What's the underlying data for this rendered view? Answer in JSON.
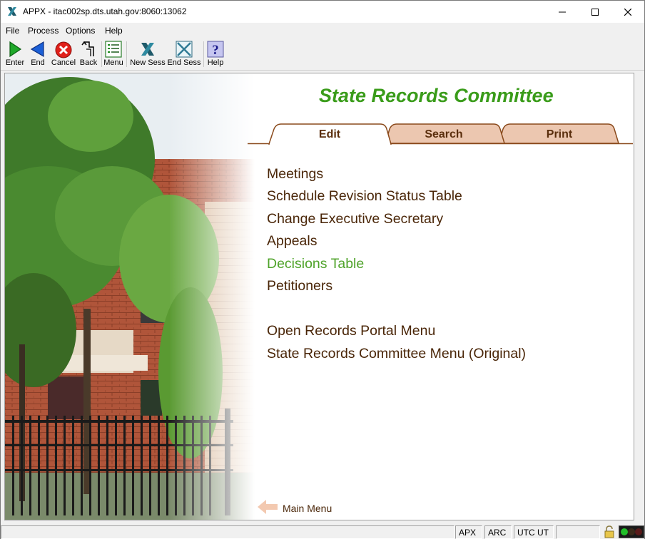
{
  "window": {
    "title": "APPX - itac002sp.dts.utah.gov:8060:13062"
  },
  "menubar": {
    "items": [
      "File",
      "Process",
      "Options",
      "Help"
    ]
  },
  "toolbar": {
    "enter": "Enter",
    "end": "End",
    "cancel": "Cancel",
    "back": "Back",
    "menu": "Menu",
    "new_sess": "New Sess",
    "end_sess": "End Sess",
    "help": "Help"
  },
  "page": {
    "title": "State Records Committee",
    "tabs": [
      {
        "label": "Edit",
        "active": true
      },
      {
        "label": "Search",
        "active": false
      },
      {
        "label": "Print",
        "active": false
      }
    ],
    "menu_items": [
      {
        "label": "Meetings",
        "highlighted": false
      },
      {
        "label": "Schedule Revision Status Table",
        "highlighted": false
      },
      {
        "label": "Change Executive Secretary",
        "highlighted": false
      },
      {
        "label": "Appeals",
        "highlighted": false
      },
      {
        "label": "Decisions Table",
        "highlighted": true
      },
      {
        "label": "Petitioners",
        "highlighted": false
      },
      {
        "label": "Open Records Portal Menu",
        "highlighted": false
      },
      {
        "label": "State Records Committee Menu (Original)",
        "highlighted": false
      }
    ],
    "main_menu": "Main Menu"
  },
  "statusbar": {
    "apx": "APX",
    "arc": "ARC",
    "timezone": "UTC UT"
  },
  "colors": {
    "title_green": "#3a9c1a",
    "highlight_green": "#4fa32a",
    "menu_brown": "#4a2608",
    "tab_fill": "#ecc7b0",
    "tab_border": "#8a4a1c"
  },
  "icons": {
    "app": "appx-x-icon",
    "enter": "play-arrow-icon",
    "end": "back-arrow-icon",
    "cancel": "cancel-x-icon",
    "back": "return-arrow-icon",
    "menu": "list-icon",
    "new_sess": "appx-x-icon",
    "end_sess": "close-box-icon",
    "help": "question-icon",
    "main_menu": "left-arrow-icon",
    "status_lock": "padlock-icon"
  }
}
